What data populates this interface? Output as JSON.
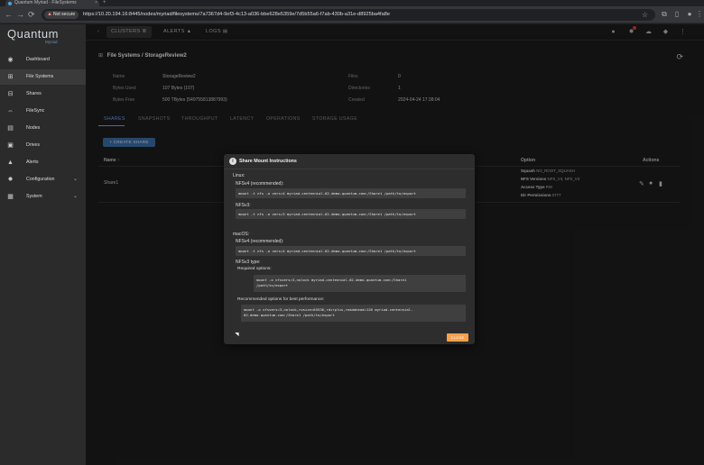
{
  "browser": {
    "tab_title": "Quantum Myriad - FileSystems",
    "tab_close": "×",
    "new_tab": "+",
    "back": "←",
    "forward": "→",
    "reload": "⟳",
    "not_secure": "Not secure",
    "url": "https://10.20.194.16:8445/nodes/myriad/filesystems/7a7367d4-9ef3-4c13-a036-bbe628e5359e/7d5b55a6-f7ab-430b-a31e-d8925ba4fa8e"
  },
  "app": {
    "logo": "Quantum",
    "logo_sub": "Myriad"
  },
  "sidebar": {
    "items": [
      {
        "label": "Dashboard"
      },
      {
        "label": "File Systems"
      },
      {
        "label": "Shares"
      },
      {
        "label": "FileSync"
      },
      {
        "label": "Nodes"
      },
      {
        "label": "Drives"
      },
      {
        "label": "Alerts"
      },
      {
        "label": "Configuration"
      },
      {
        "label": "System"
      }
    ]
  },
  "topbar": {
    "back_chevron": "‹",
    "tabs": [
      {
        "label": "CLUSTERS"
      },
      {
        "label": "ALERTS"
      },
      {
        "label": "LOGS"
      }
    ]
  },
  "breadcrumb": {
    "section": "File Systems",
    "separator": "/",
    "current": "StorageReview2"
  },
  "info": {
    "name_label": "Name",
    "name_value": "StorageReview2",
    "used_label": "Bytes Used",
    "used_value": "107 Bytes (107)",
    "free_label": "Bytes Free",
    "free_value": "500 TBytes (549755813887993)",
    "files_label": "Files",
    "files_value": "0",
    "dirs_label": "Directories",
    "dirs_value": "1",
    "created_label": "Created",
    "created_value": "2024-04-24 17:38:04"
  },
  "subtabs": [
    {
      "label": "SHARES"
    },
    {
      "label": "SNAPSHOTS"
    },
    {
      "label": "THROUGHPUT"
    },
    {
      "label": "LATENCY"
    },
    {
      "label": "OPERATIONS"
    },
    {
      "label": "STORAGE USAGE"
    }
  ],
  "create_share": "+ CREATE SHARE",
  "table": {
    "col_name": "Name ↑",
    "col_option": "Option",
    "col_actions": "Actions",
    "row": {
      "name": "Share1",
      "squash_label": "Squash",
      "squash_value": "NO_ROOT_SQUASH",
      "nfs_label": "NFS Versions",
      "nfs_value": "NFS_V4, NFS_V3",
      "access_label": "Access Type",
      "access_value": "RW",
      "dirperm_label": "Dir Permissions",
      "dirperm_value": "0777"
    }
  },
  "modal": {
    "title": "Share Mount Instructions",
    "linux_heading": "Linux:",
    "linux_nfsv4_label": "NFSv4 (recommended):",
    "linux_nfsv4_cmd": "mount -t nfs -o vers=4 myriad-centennial-02.demo.quantum.com:/Share1 /path/to/export",
    "linux_nfsv3_label": "NFSv3:",
    "linux_nfsv3_cmd": "mount -t nfs -o vers=3 myriad-centennial-02.demo.quantum.com:/Share1 /path/to/export",
    "mac_heading": "macOS:",
    "mac_nfsv4_label": "NFSv4 (recommended):",
    "mac_nfsv4_cmd": "mount -t nfs -o vers=4 myriad-centennial-02.demo.quantum.com:/Share1 /path/to/export",
    "mac_nfsv3_label": "NFSv3 type:",
    "mac_required_label": "Required options:",
    "mac_required_cmd": "mount -o nfsvers=3,nolock myriad-centennial-02.demo.quantum.com:/Share1\n/path/to/export",
    "mac_perf_label": "Recommended options for best performance:",
    "mac_perf_cmd": "mount -o nfsvers=3,nolock,rwsize=65536,rdirplus,readahead=128 myriad-centennial-\n02.demo.quantum.com:/Share1 /path/to/export",
    "close_label": "CLOSE"
  }
}
